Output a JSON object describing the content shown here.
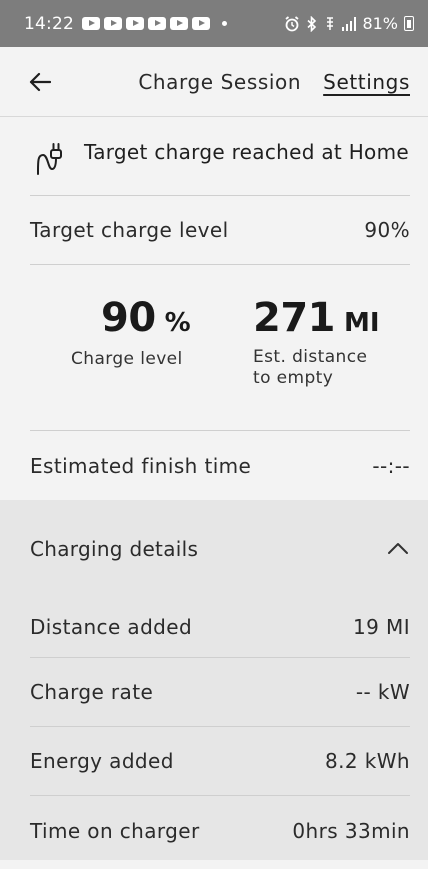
{
  "status_bar": {
    "time": "14:22",
    "battery_percent": "81%",
    "notification_icon_count": 6
  },
  "header": {
    "title": "Charge Session",
    "settings_label": "Settings"
  },
  "alert": {
    "message": "Target charge reached at Home"
  },
  "target_charge": {
    "label": "Target charge level",
    "value": "90%"
  },
  "stats": {
    "charge_level": {
      "value": "90",
      "unit": "%",
      "label": "Charge level"
    },
    "distance": {
      "value": "271",
      "unit": "MI",
      "label": "Est. distance to empty"
    }
  },
  "finish_time": {
    "label": "Estimated finish time",
    "value": "--:--"
  },
  "charging_details": {
    "title": "Charging details",
    "rows": [
      {
        "label": "Distance added",
        "value": "19 MI"
      },
      {
        "label": "Charge rate",
        "value": "-- kW"
      },
      {
        "label": "Energy added",
        "value": "8.2 kWh"
      },
      {
        "label": "Time on charger",
        "value": "0hrs 33min"
      }
    ]
  },
  "colors": {
    "status_bar": "#7d7d7d",
    "background": "#f3f3f3",
    "details_background": "#e6e6e6"
  }
}
